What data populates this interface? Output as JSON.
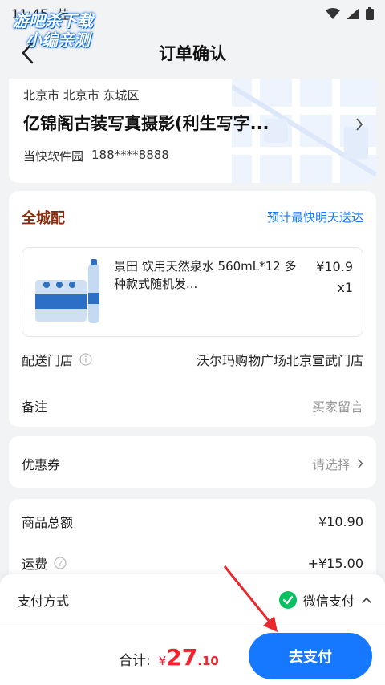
{
  "status_bar": {
    "time": "11:45",
    "extra": "荭"
  },
  "watermark": {
    "line1": "游吧杀下载",
    "line2": "小编亲测"
  },
  "nav": {
    "title": "订单确认"
  },
  "address": {
    "region": "北京市 北京市 东城区",
    "name": "亿锦阁古装写真摄影(利生写字...",
    "contact_name": "当快软件园",
    "phone": "188****8888"
  },
  "delivery": {
    "tag": "全城配",
    "eta": "预计最快明天送达",
    "product": {
      "name": "景田 饮用天然泉水 560mL*12 多种款式随机发...",
      "price": "¥10.9",
      "qty": "x1"
    },
    "store_label": "配送门店",
    "store_value": "沃尔玛购物广场北京宣武门店",
    "remark_label": "备注",
    "remark_placeholder": "买家留言"
  },
  "coupon": {
    "label": "优惠券",
    "value": "请选择"
  },
  "totals": {
    "goods_label": "商品总额",
    "goods_value": "¥10.90",
    "freight_label": "运费",
    "freight_value": "+¥15.00"
  },
  "payment": {
    "label": "支付方式",
    "method": "微信支付"
  },
  "footer": {
    "total_label": "合计:",
    "currency": "¥",
    "amount_int": "27",
    "amount_dec": ".10",
    "pay_button": "去支付"
  },
  "colors": {
    "accent": "#1677ff",
    "price_red": "#f5222d",
    "tag_brown": "#8b2b0d",
    "wechat_green": "#07c160"
  }
}
